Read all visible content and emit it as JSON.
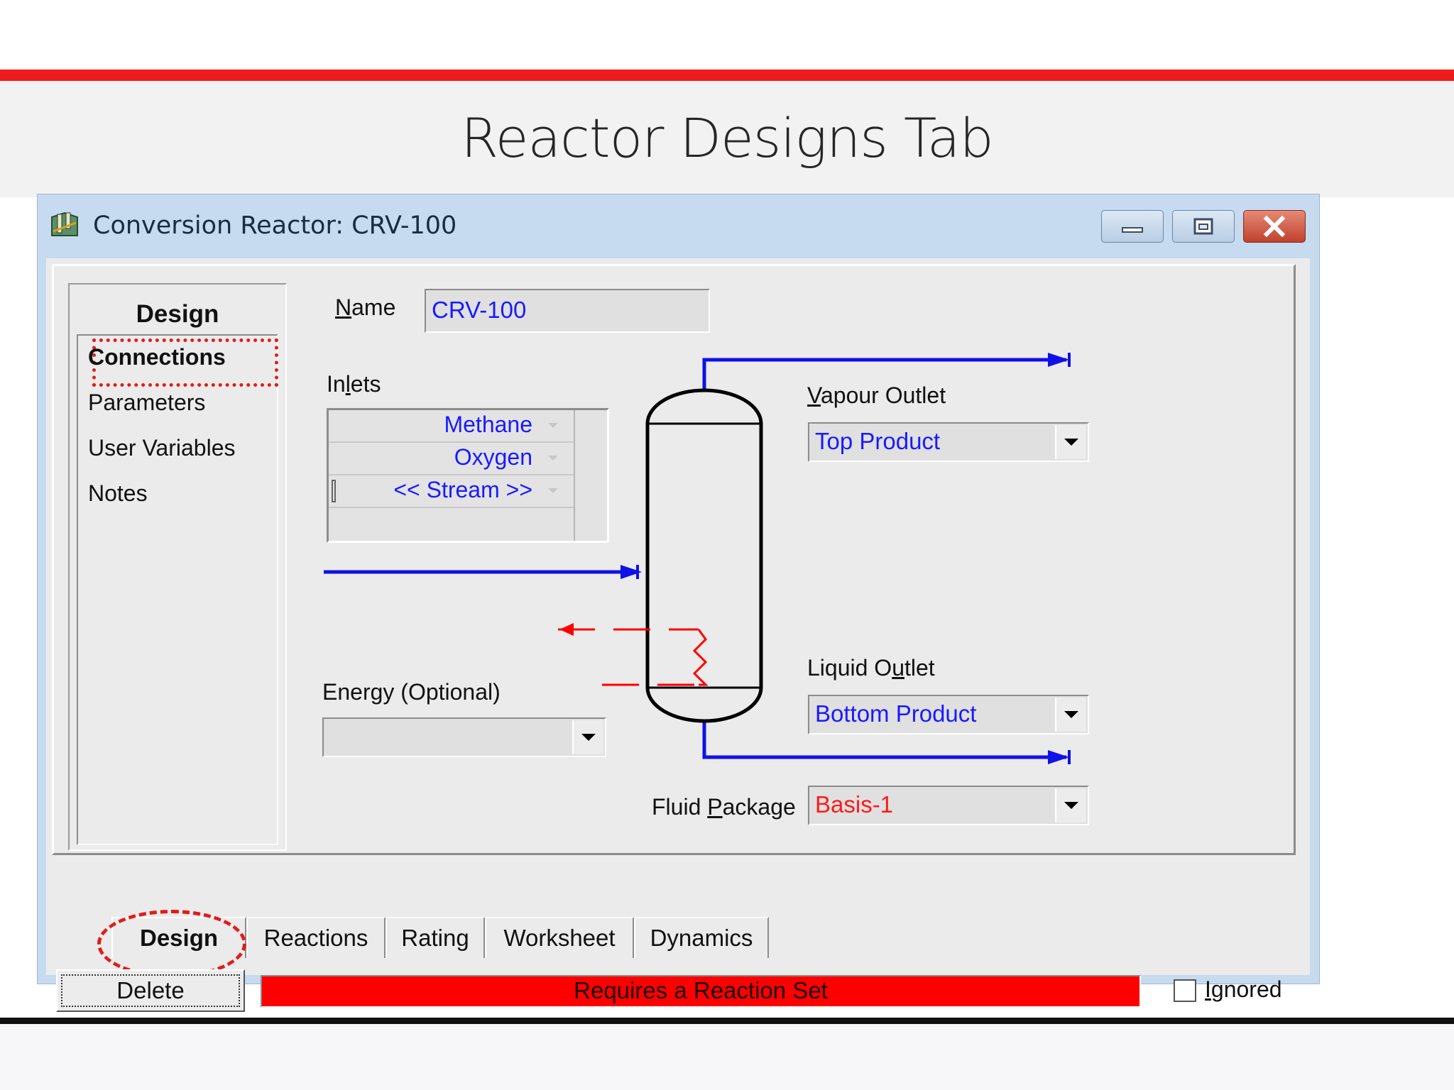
{
  "slide": {
    "title": "Reactor Designs Tab"
  },
  "window": {
    "title": "Conversion Reactor: CRV-100",
    "controls": {
      "minimize": "minimize-icon",
      "maximize": "maximize-icon",
      "close": "close-icon"
    }
  },
  "nav": {
    "heading": "Design",
    "items": [
      {
        "label": "Connections",
        "active": true
      },
      {
        "label": "Parameters"
      },
      {
        "label": "User Variables"
      },
      {
        "label": "Notes"
      }
    ]
  },
  "form": {
    "name_label_pre": "",
    "name_label_u": "N",
    "name_label_post": "ame",
    "name_value": "CRV-100",
    "inlets_label_pre": "In",
    "inlets_label_u": "l",
    "inlets_label_post": "ets",
    "inlets": [
      "Methane",
      "Oxygen",
      "<< Stream >>"
    ],
    "vapour_label_pre": "",
    "vapour_label_u": "V",
    "vapour_label_post": "apour Outlet",
    "vapour_value": "Top Product",
    "liquid_label_pre": "Liquid O",
    "liquid_label_u": "u",
    "liquid_label_post": "tlet",
    "liquid_value": "Bottom Product",
    "energy_label_pre": "Ener",
    "energy_label_u": "g",
    "energy_label_post": "y (Optional)",
    "energy_value": "",
    "fluid_label_pre": "Fluid ",
    "fluid_label_u": "P",
    "fluid_label_post": "ackage",
    "fluid_value": "Basis-1"
  },
  "tabs": [
    {
      "label": "Design",
      "active": true
    },
    {
      "label": "Reactions"
    },
    {
      "label": "Rating"
    },
    {
      "label": "Worksheet"
    },
    {
      "label": "Dynamics"
    }
  ],
  "footer": {
    "delete_label": "Delete",
    "status": "Requires a Reaction Set",
    "ignored_label_pre": "",
    "ignored_label_u": "I",
    "ignored_label_post": "gnored",
    "ignored_checked": false
  },
  "colors": {
    "accent": "#ee1c1c",
    "stream": "#1010e8",
    "energy": "#ff0000",
    "value_text": "#1a1aff",
    "status_bg": "#ff0000"
  }
}
